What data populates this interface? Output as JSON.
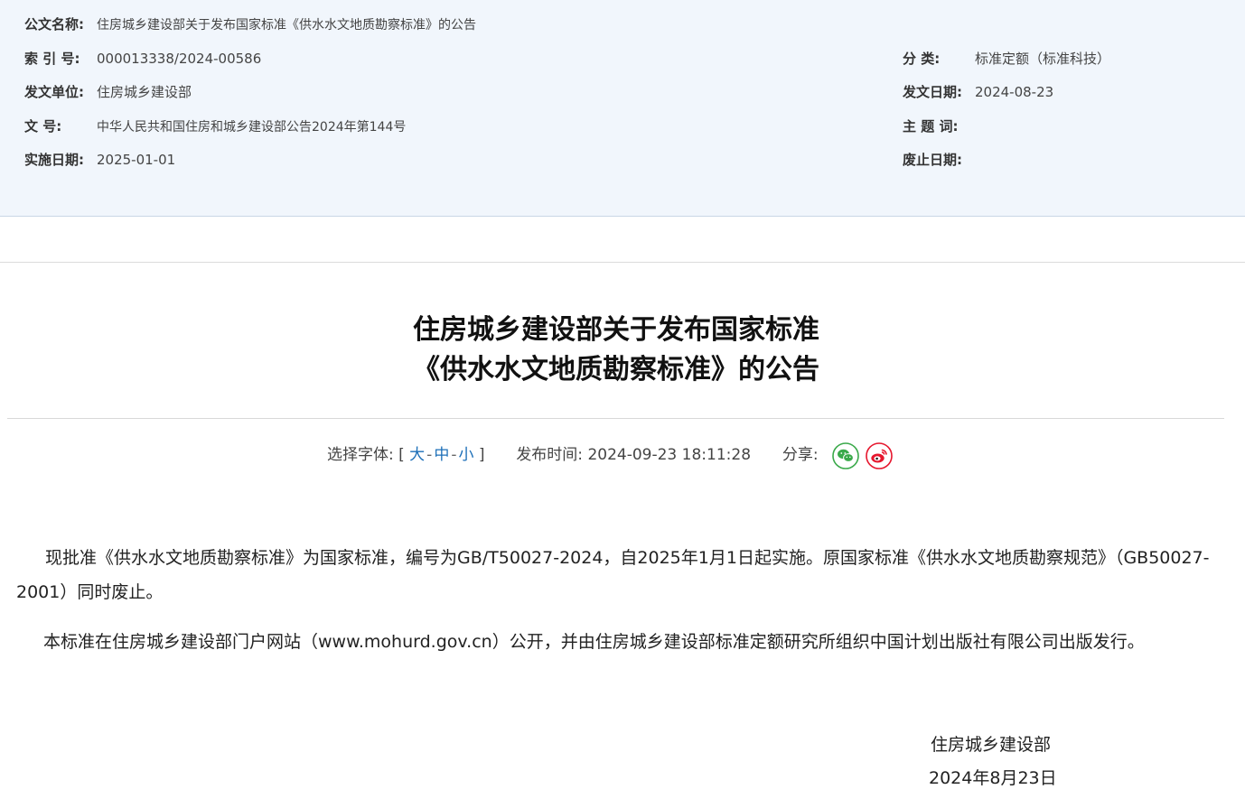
{
  "meta": {
    "name_label": "公文名称:",
    "name_value": "住房城乡建设部关于发布国家标准《供水水文地质勘察标准》的公告",
    "index_label": "索 引 号:",
    "index_value": "000013338/2024-00586",
    "category_label": "分 类:",
    "category_value": "标准定额（标准科技）",
    "issuer_label": "发文单位:",
    "issuer_value": "住房城乡建设部",
    "issue_date_label": "发文日期:",
    "issue_date_value": "2024-08-23",
    "doc_no_label": "文 号:",
    "doc_no_value": "中华人民共和国住房和城乡建设部公告2024年第144号",
    "keywords_label": "主 题 词:",
    "keywords_value": "",
    "effective_label": "实施日期:",
    "effective_value": "2025-01-01",
    "abolish_label": "废止日期:",
    "abolish_value": ""
  },
  "title": {
    "line1": "住房城乡建设部关于发布国家标准",
    "line2": "《供水水文地质勘察标准》的公告"
  },
  "tools": {
    "font_label": "选择字体: [",
    "font_large": "大",
    "font_medium": "中",
    "font_small": "小",
    "font_close": "]",
    "separator": "-",
    "publish_label": "发布时间:",
    "publish_time": "2024-09-23 18:11:28",
    "share_label": "分享:",
    "wechat_color": "#3aa94a",
    "weibo_color": "#e6162d"
  },
  "content": {
    "para1": "现批准《供水水文地质勘察标准》为国家标准，编号为GB/T50027-2024，自2025年1月1日起实施。原国家标准《供水水文地质勘察规范》（GB50027-2001）同时废止。",
    "para2": "本标准在住房城乡建设部门户网站（www.mohurd.gov.cn）公开，并由住房城乡建设部标准定额研究所组织中国计划出版社有限公司出版发行。",
    "signer": "住房城乡建设部",
    "sign_date": "2024年8月23日"
  }
}
